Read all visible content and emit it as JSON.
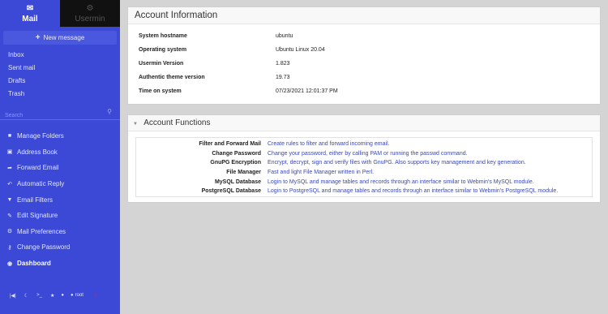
{
  "sidebar": {
    "tabs": [
      {
        "label": "Mail",
        "icon": "envelope-icon"
      },
      {
        "label": "Usermin",
        "icon": "gear-icon"
      }
    ],
    "new_message": "New message",
    "folders": [
      "Inbox",
      "Sent mail",
      "Drafts",
      "Trash"
    ],
    "search_placeholder": "Search",
    "menu": [
      {
        "label": "Manage Folders",
        "icon": "folder-icon"
      },
      {
        "label": "Address Book",
        "icon": "address-book-icon"
      },
      {
        "label": "Forward Email",
        "icon": "forward-icon"
      },
      {
        "label": "Automatic Reply",
        "icon": "reply-icon"
      },
      {
        "label": "Email Filters",
        "icon": "filter-icon"
      },
      {
        "label": "Edit Signature",
        "icon": "pencil-icon"
      },
      {
        "label": "Mail Preferences",
        "icon": "gear-icon"
      },
      {
        "label": "Change Password",
        "icon": "key-icon"
      },
      {
        "label": "Dashboard",
        "icon": "dashboard-icon"
      }
    ],
    "user": "root",
    "accent_color": "#3b49d6"
  },
  "account": {
    "title": "Account Information",
    "rows": [
      {
        "label": "System hostname",
        "value": "ubuntu"
      },
      {
        "label": "Operating system",
        "value": "Ubuntu Linux 20.04"
      },
      {
        "label": "Usermin Version",
        "value": "1.823"
      },
      {
        "label": "Authentic theme version",
        "value": "19.73"
      },
      {
        "label": "Time on system",
        "value": "07/23/2021 12:01:37 PM"
      }
    ]
  },
  "functions": {
    "title": "Account Functions",
    "rows": [
      {
        "name": "Filter and Forward Mail",
        "desc": "Create rules to filter and forward incoming email."
      },
      {
        "name": "Change Password",
        "desc": "Change your password, either by calling PAM or running the passwd command."
      },
      {
        "name": "GnuPG Encryption",
        "desc": "Encrypt, decrypt, sign and verify files with GnuPG. Also supports key management and key generation."
      },
      {
        "name": "File Manager",
        "desc": "Fast and light File Manager written in Perl."
      },
      {
        "name": "MySQL Database",
        "desc": "Login to MySQL and manage tables and records through an interface similar to Webmin's MySQL module."
      },
      {
        "name": "PostgreSQL Database",
        "desc": "Login to PostgreSQL and manage tables and records through an interface similar to Webmin's PostgreSQL module."
      }
    ]
  }
}
